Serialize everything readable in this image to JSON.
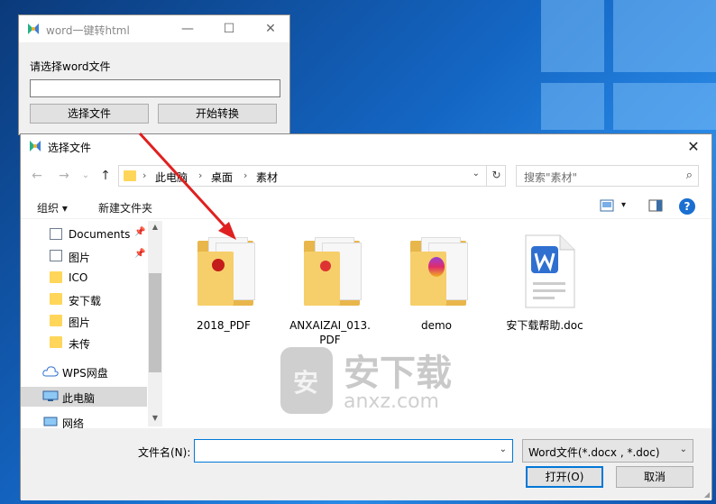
{
  "converter_window": {
    "title": "word一键转html",
    "prompt_label": "请选择word文件",
    "file_path_value": "",
    "choose_button": "选择文件",
    "convert_button": "开始转换",
    "minimize_glyph": "—",
    "maximize_glyph": "☐",
    "close_glyph": "✕"
  },
  "dialog": {
    "title": "选择文件",
    "close_glyph": "✕",
    "back_glyph": "←",
    "forward_glyph": "→",
    "history_glyph": "⌄",
    "up_glyph": "↑",
    "breadcrumb": [
      "此电脑",
      "桌面",
      "素材"
    ],
    "breadcrumb_sep": "›",
    "refresh_glyph": "↻",
    "search_placeholder": "搜索\"素材\"",
    "search_glyph": "⌕",
    "organize_label": "组织 ▾",
    "new_folder_label": "新建文件夹",
    "view_glyph": "▾",
    "help_glyph": "?",
    "sidebar": [
      {
        "label": "Documents",
        "icon": "document-icon",
        "pinned": true
      },
      {
        "label": "图片",
        "icon": "pictures-icon",
        "pinned": true
      },
      {
        "label": "ICO",
        "icon": "folder-icon",
        "pinned": false
      },
      {
        "label": "安下载",
        "icon": "folder-icon",
        "pinned": false
      },
      {
        "label": "图片",
        "icon": "folder-icon",
        "pinned": false
      },
      {
        "label": "未传",
        "icon": "folder-icon",
        "pinned": false
      },
      {
        "label": "WPS网盘",
        "icon": "cloud-icon",
        "pinned": false
      },
      {
        "label": "此电脑",
        "icon": "computer-icon",
        "pinned": false,
        "selected": true
      },
      {
        "label": "网络",
        "icon": "network-icon",
        "pinned": false
      }
    ],
    "pin_glyph": "📌",
    "files": [
      {
        "name": "2018_PDF",
        "type": "folder"
      },
      {
        "name": "ANXAIZAI_013.\nPDF",
        "type": "folder"
      },
      {
        "name": "demo",
        "type": "folder"
      },
      {
        "name": "安下载帮助.doc",
        "type": "wps-doc"
      }
    ],
    "filename_label": "文件名(N):",
    "filename_value": "",
    "filetype_value": "Word文件(*.docx , *.doc)",
    "open_button": "打开(O)",
    "cancel_button": "取消",
    "dropdown_glyph": "⌄"
  },
  "watermark": {
    "main": "安下载",
    "sub": "anxz.com",
    "shield": "安"
  },
  "colors": {
    "accent": "#0078d7",
    "arrow": "#e02020",
    "folder": "#f6cf6a"
  }
}
